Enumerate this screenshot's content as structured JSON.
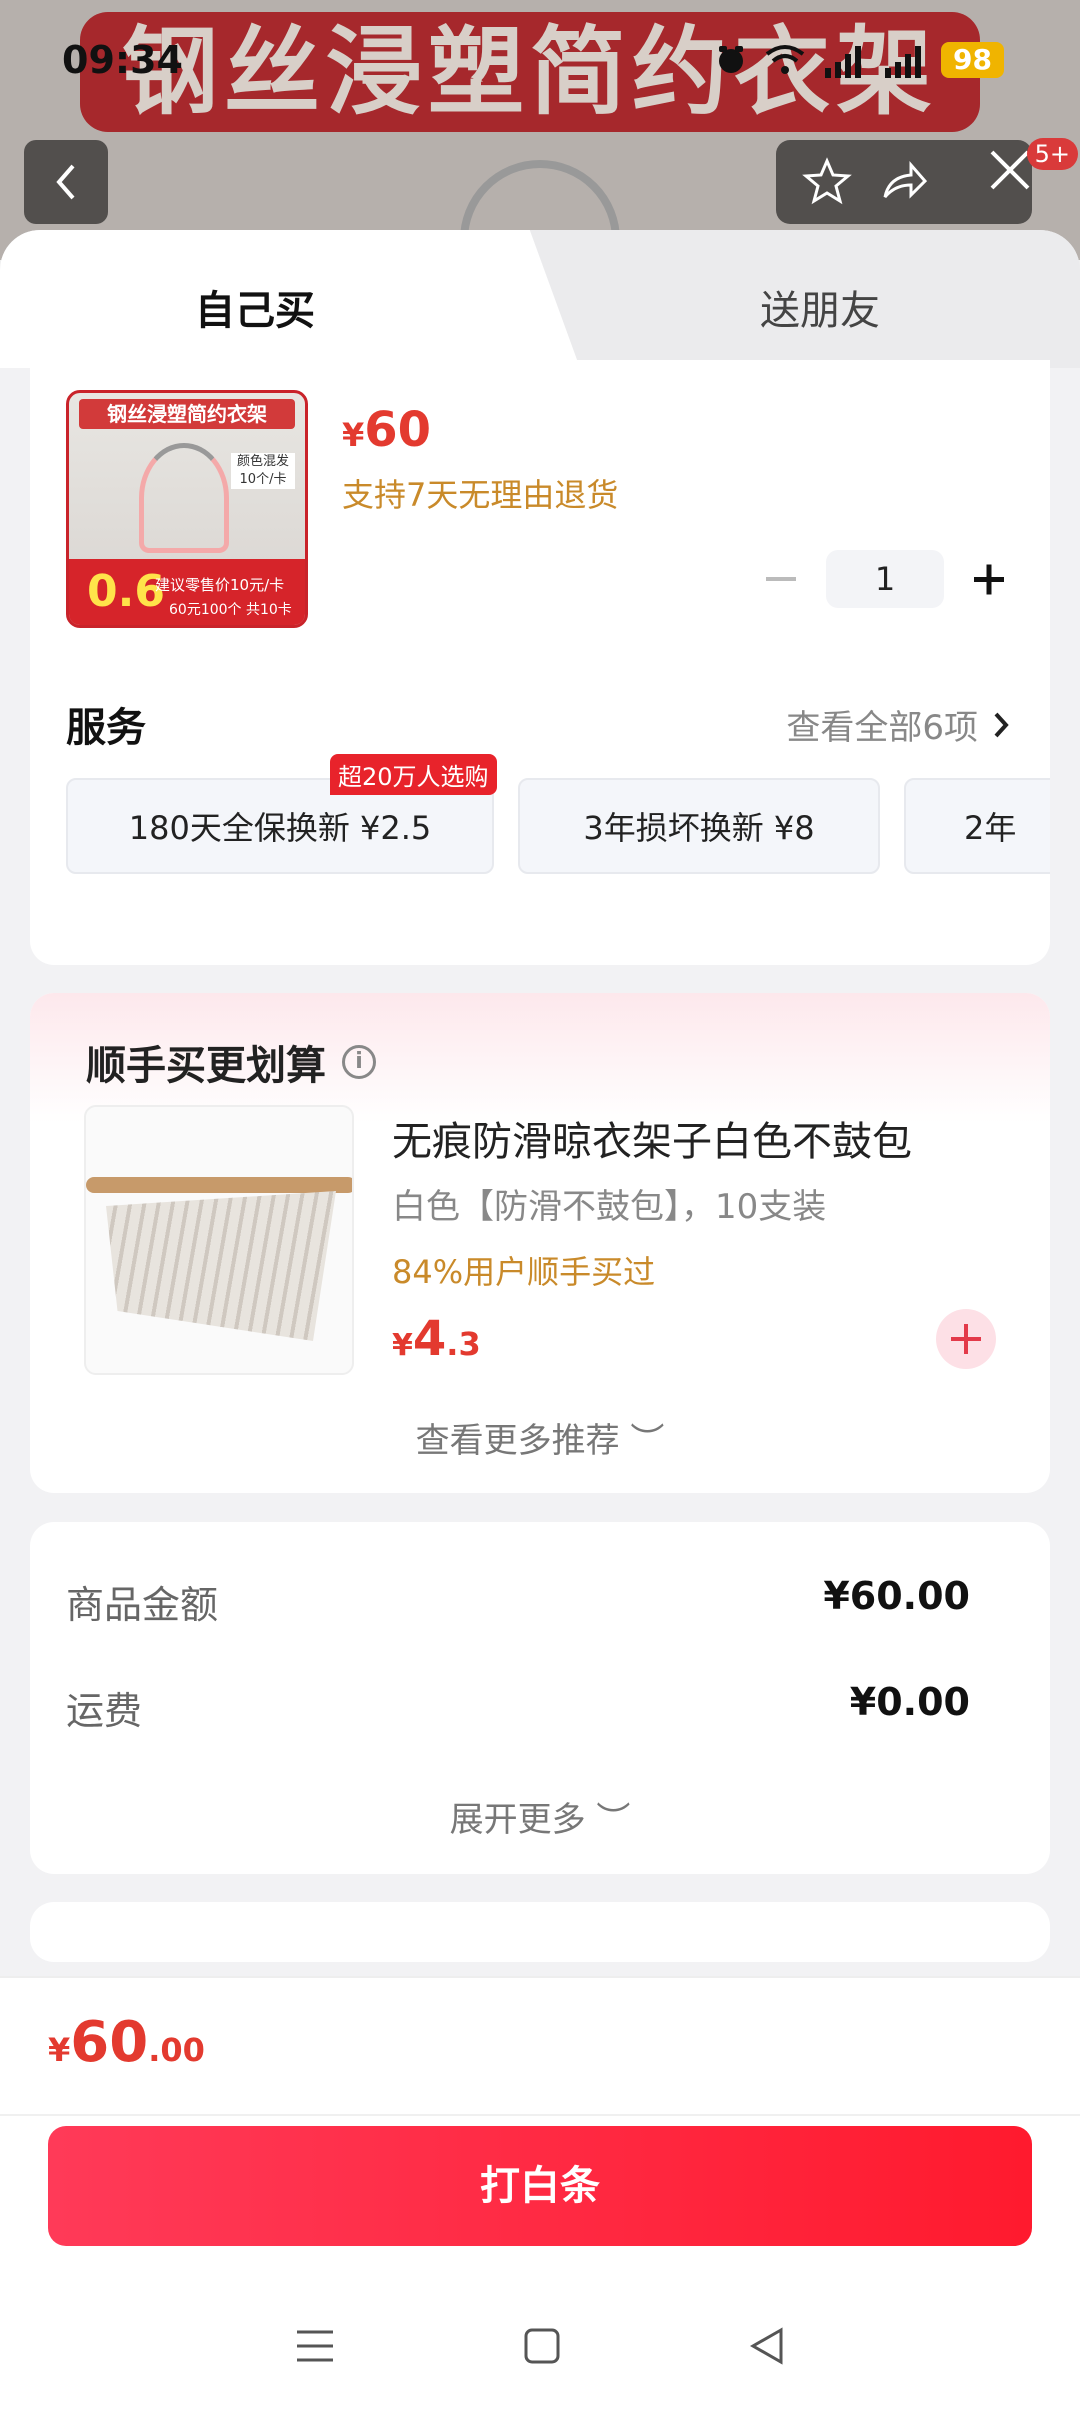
{
  "status_bar": {
    "time": "09:34",
    "battery": "98"
  },
  "hero": {
    "banner_text": "钢丝浸塑简约衣架",
    "badge": "5+"
  },
  "tabs": [
    {
      "label": "自己买"
    },
    {
      "label": "送朋友"
    }
  ],
  "product": {
    "image_title": "钢丝浸塑简约衣架",
    "image_tag_line1": "颜色混发",
    "image_tag_line2": "10个/卡",
    "image_price": "0.6",
    "image_note": "建议零售价10元/卡",
    "image_note2": "60元100个 共10卡",
    "currency": "¥",
    "price": "60",
    "return_policy": "支持7天无理由退货",
    "quantity": "1"
  },
  "services": {
    "title": "服务",
    "view_all": "查看全部6项",
    "hot_tag": "超20万人选购",
    "items": [
      {
        "label": "180天全保换新  ¥2.5"
      },
      {
        "label": "3年损坏换新  ¥8"
      },
      {
        "label": "2年"
      }
    ]
  },
  "recommend": {
    "title": "顺手买更划算",
    "name": "无痕防滑晾衣架子白色不鼓包",
    "spec": "白色【防滑不鼓包】，10支装",
    "bought": "84%用户顺手买过",
    "currency": "¥",
    "price_int": "4",
    "price_dec": ".3",
    "more": "查看更多推荐"
  },
  "summary": {
    "goods_label": "商品金额",
    "goods_value": "¥60.00",
    "shipping_label": "运费",
    "shipping_value": "¥0.00",
    "expand": "展开更多"
  },
  "footer": {
    "currency": "¥",
    "total_int": "60",
    "total_dec": ".00",
    "pay_button": "打白条"
  },
  "colors": {
    "accent": "#e33a2f",
    "button": "#ff2a40",
    "gold": "#c98a2a"
  }
}
